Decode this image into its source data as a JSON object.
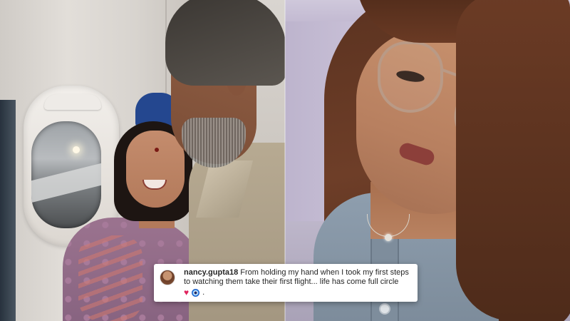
{
  "comment": {
    "username": "nancy.gupta18",
    "text": "From holding my hand when I took my first steps to watching them take their first flight... life has come full circle",
    "emoji_trailing": ".",
    "emojis": [
      "heart-icon",
      "evil-eye-icon"
    ]
  },
  "colors": {
    "heart": "#e0245e",
    "card_bg": "#ffffff",
    "text": "#262626"
  }
}
